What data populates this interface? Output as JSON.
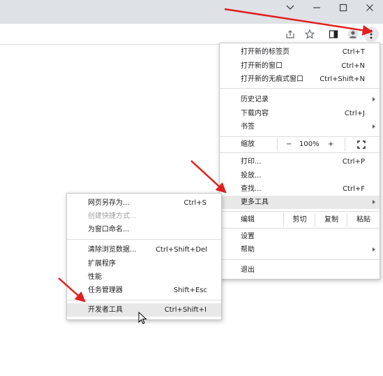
{
  "window_controls": {
    "tabsearch": "⌄",
    "minimize": "–",
    "maximize": "☐",
    "close": "✕"
  },
  "toolbar_icons": [
    "share-icon",
    "star-icon",
    "side-panel-icon",
    "profile-icon",
    "kebab-menu-icon"
  ],
  "main_menu": {
    "new_tab": {
      "label": "打开新的标签页",
      "shortcut": "Ctrl+T"
    },
    "new_window": {
      "label": "打开新的窗口",
      "shortcut": "Ctrl+N"
    },
    "new_incognito": {
      "label": "打开新的无痕式窗口",
      "shortcut": "Ctrl+Shift+N"
    },
    "history": {
      "label": "历史记录"
    },
    "downloads": {
      "label": "下载内容",
      "shortcut": "Ctrl+J"
    },
    "bookmarks": {
      "label": "书签"
    },
    "zoom": {
      "label": "缩放",
      "minus": "−",
      "value": "100%",
      "plus": "+"
    },
    "print": {
      "label": "打印...",
      "shortcut": "Ctrl+P"
    },
    "cast": {
      "label": "投放..."
    },
    "find": {
      "label": "查找...",
      "shortcut": "Ctrl+F"
    },
    "more_tools": {
      "label": "更多工具"
    },
    "edit": {
      "label": "编辑",
      "cut": "剪切",
      "copy": "复制",
      "paste": "粘贴"
    },
    "settings": {
      "label": "设置"
    },
    "help": {
      "label": "帮助"
    },
    "exit": {
      "label": "退出"
    }
  },
  "sub_menu": {
    "save_page": {
      "label": "网页另存为...",
      "shortcut": "Ctrl+S"
    },
    "create_shortcut": {
      "label": "创建快捷方式..."
    },
    "name_window": {
      "label": "为窗口命名..."
    },
    "clear_data": {
      "label": "清除浏览数据...",
      "shortcut": "Ctrl+Shift+Del"
    },
    "extensions": {
      "label": "扩展程序"
    },
    "performance": {
      "label": "性能"
    },
    "task_manager": {
      "label": "任务管理器",
      "shortcut": "Shift+Esc"
    },
    "dev_tools": {
      "label": "开发者工具",
      "shortcut": "Ctrl+Shift+I"
    }
  },
  "colors": {
    "annotation_arrow": "#e02020",
    "highlight": "#e8e8e8",
    "titlebar": "#dee1e6"
  }
}
